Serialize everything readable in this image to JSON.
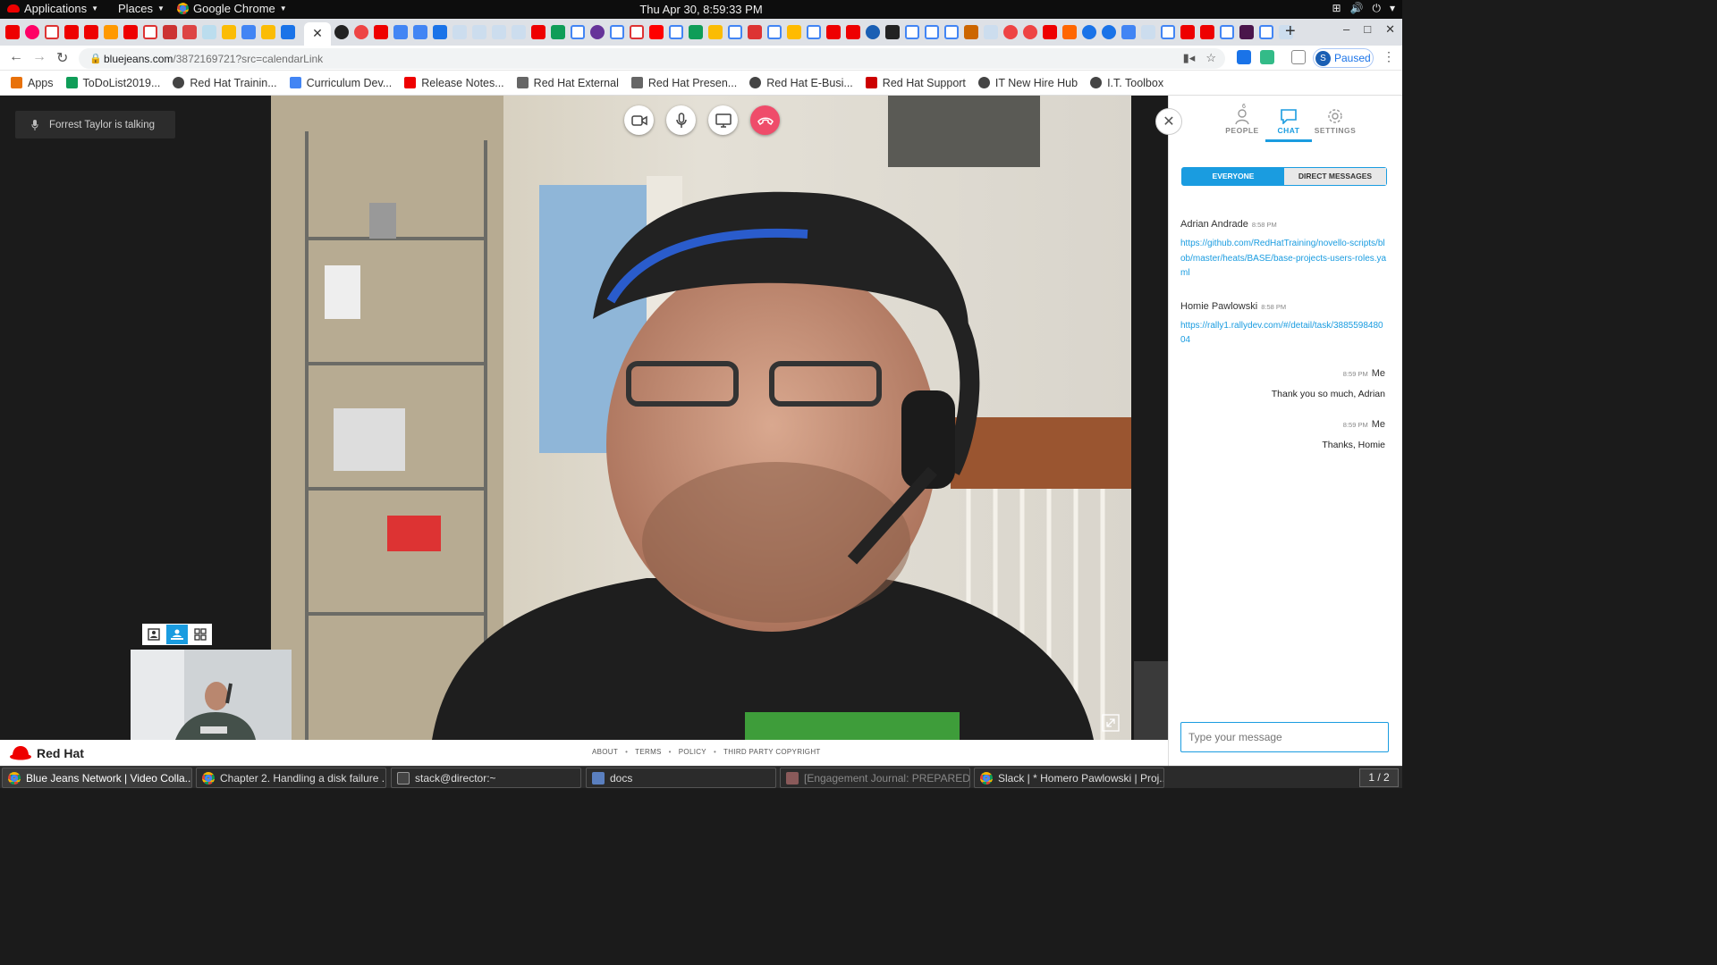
{
  "system": {
    "applications_label": "Applications",
    "places_label": "Places",
    "browser_label": "Google Chrome",
    "clock": "Thu Apr 30,  8:59:33 PM"
  },
  "browser": {
    "url_host": "bluejeans.com",
    "url_rest": "/3872169721?src=calendarLink",
    "profile_initial": "S",
    "profile_status": "Paused",
    "close_tab": "✕",
    "new_tab": "+"
  },
  "bookmarks": [
    {
      "label": "Apps",
      "icon": "apps-grid-icon",
      "color": "#e8710a"
    },
    {
      "label": "ToDoList2019...",
      "icon": "sheets-icon",
      "color": "#0f9d58"
    },
    {
      "label": "Red Hat Trainin...",
      "icon": "globe-icon",
      "color": "#444"
    },
    {
      "label": "Curriculum Dev...",
      "icon": "docs-icon",
      "color": "#4285f4"
    },
    {
      "label": "Release Notes...",
      "icon": "redhat-icon",
      "color": "#e00"
    },
    {
      "label": "Red Hat External",
      "icon": "folder-icon",
      "color": "#666"
    },
    {
      "label": "Red Hat Presen...",
      "icon": "folder-icon",
      "color": "#666"
    },
    {
      "label": "Red Hat E-Busi...",
      "icon": "globe-icon",
      "color": "#444"
    },
    {
      "label": "Red Hat Support",
      "icon": "support-icon",
      "color": "#c00"
    },
    {
      "label": "IT New Hire Hub",
      "icon": "globe-icon",
      "color": "#444"
    },
    {
      "label": "I.T. Toolbox",
      "icon": "globe-icon",
      "color": "#444"
    }
  ],
  "meeting": {
    "speaker_status": "Forrest Taylor is talking"
  },
  "panel": {
    "tabs": [
      {
        "label": "PEOPLE",
        "count": "6"
      },
      {
        "label": "CHAT"
      },
      {
        "label": "SETTINGS"
      }
    ],
    "segments": [
      "EVERYONE",
      "DIRECT MESSAGES"
    ],
    "messages": [
      {
        "author": "Adrian Andrade",
        "time": "8:58 PM",
        "text": "https://github.com/RedHatTraining/novello-scripts/blob/master/heats/BASE/base-projects-users-roles.yaml"
      },
      {
        "author": "Homie Pawlowski",
        "time": "8:58 PM",
        "text": "https://rally1.rallydev.com/#/detail/task/388559848004"
      },
      {
        "author": "Me",
        "time": "8:59 PM",
        "text": "Thank you so much, Adrian"
      },
      {
        "author": "Me",
        "time": "8:59 PM",
        "text": "Thanks, Homie"
      }
    ],
    "input_placeholder": "Type your message"
  },
  "footer": {
    "brand": "Red Hat",
    "links": [
      "ABOUT",
      "TERMS",
      "POLICY",
      "THIRD PARTY COPYRIGHT"
    ]
  },
  "taskbar": {
    "tasks": [
      "Blue Jeans Network | Video Colla...",
      "Chapter 2. Handling a disk failure ...",
      "stack@director:~",
      "docs",
      "[Engagement Journal: PREPARED ...",
      "Slack | * Homero Pawlowski | Proj..."
    ],
    "workspace": "1 / 2"
  },
  "colors": {
    "accent": "#1a9ce0",
    "hangup": "#ef4c6a",
    "brand_red": "#ee0000"
  }
}
